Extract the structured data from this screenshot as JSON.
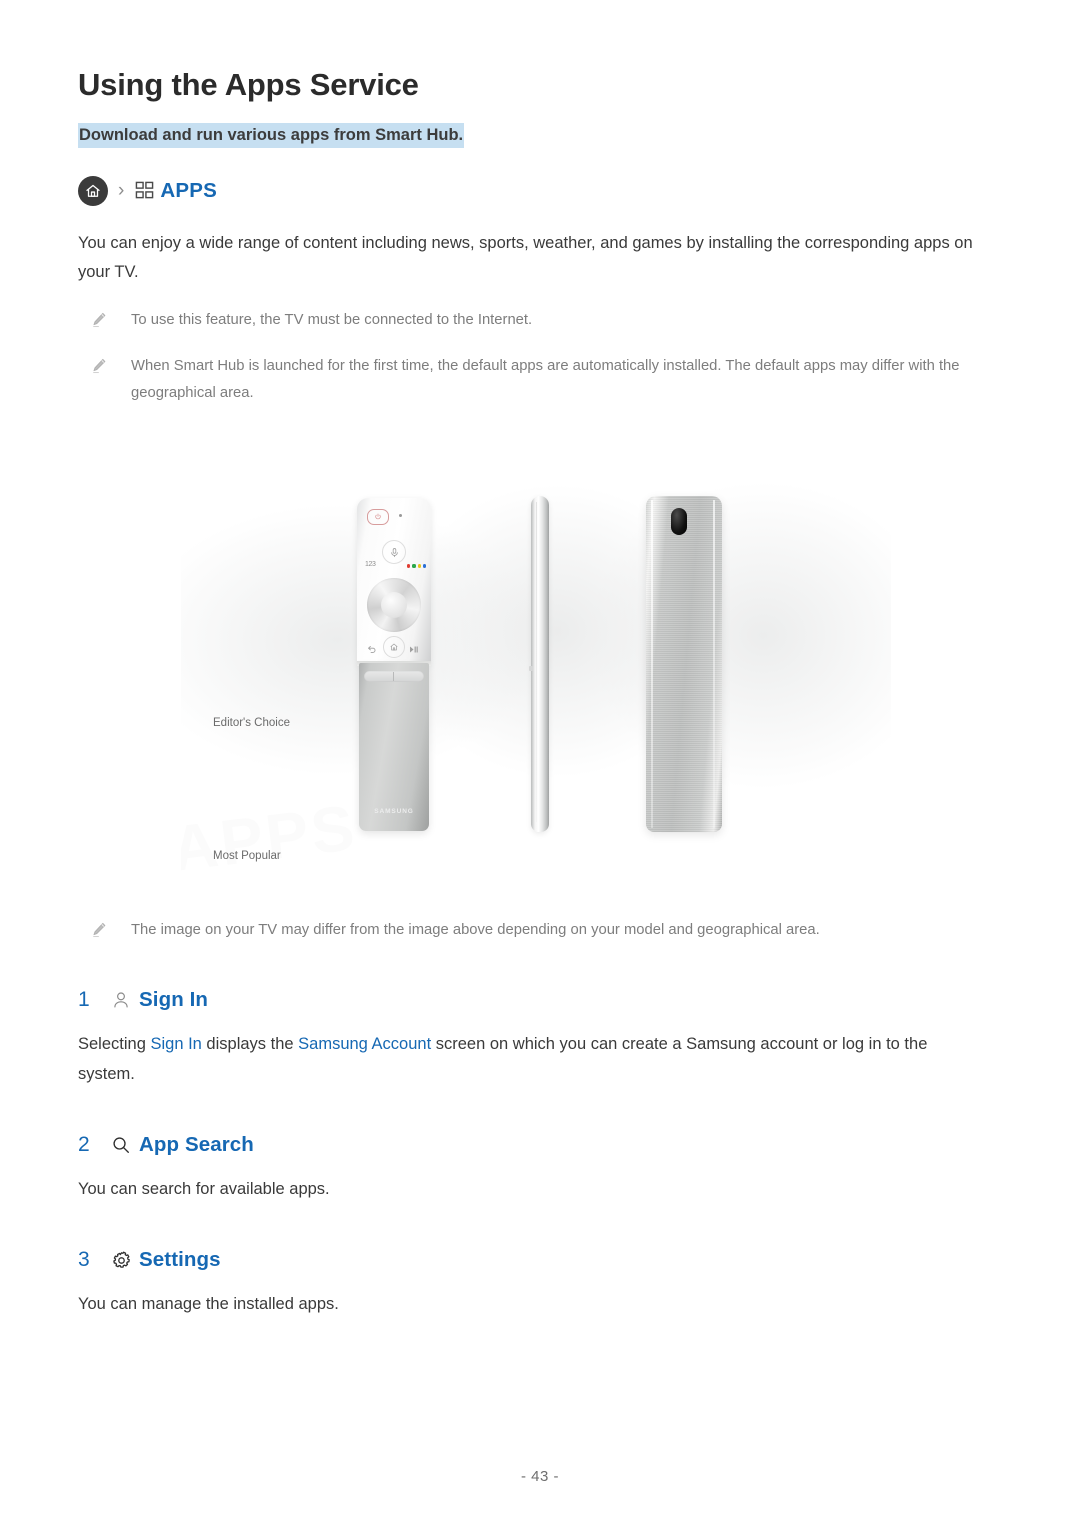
{
  "document": {
    "title": "Using the Apps Service",
    "subtitle": "Download and run various apps from Smart Hub.",
    "page_number": "- 43 -",
    "accent_color": "#1668b3",
    "highlight_color": "#c6dff1",
    "note_color": "#7d7d7d",
    "body_color": "#3a3a3a"
  },
  "breadcrumb": {
    "home_icon": "home-icon",
    "separator": "›",
    "grid_icon": "apps-grid-icon",
    "label": "APPS"
  },
  "intro": {
    "paragraph": "You can enjoy a wide range of content including news, sports, weather, and games by installing the corresponding apps on your TV."
  },
  "notes": [
    {
      "icon": "pencil-icon",
      "text": "To use this feature, the TV must be connected to the Internet."
    },
    {
      "icon": "pencil-icon",
      "text": "When Smart Hub is launched for the first time, the default apps are automatically installed. The default apps may differ with the geographical area."
    }
  ],
  "figure": {
    "watermark": "APPS",
    "caption_editors_choice": "Editor's Choice",
    "caption_most_popular": "Most Popular",
    "remote_front": {
      "power_icon": "power-icon",
      "led_indicator": "led-dot",
      "mic_icon": "microphone-icon",
      "numeric_label": "123",
      "color_buttons": [
        "#e03c31",
        "#2aa74a",
        "#e8c61c",
        "#2a6fd6"
      ],
      "dpad_icon": "directional-pad",
      "back_icon": "back-arrow-icon",
      "home_icon": "home-icon",
      "play_pause_icon": "play-pause-icon",
      "rocker_icon": "volume-channel-rocker",
      "brand": "SAMSUNG"
    },
    "remote_back": {
      "ir_window_icon": "ir-window"
    },
    "note": {
      "icon": "pencil-icon",
      "text": "The image on your TV may differ from the image above depending on your model and geographical area."
    }
  },
  "sections": [
    {
      "number": "1",
      "icon": "person-icon",
      "label": "Sign In",
      "body_prefix": "Selecting ",
      "link_1": "Sign In",
      "body_middle": " displays the ",
      "link_2": "Samsung Account",
      "body_suffix": " screen on which you can create a Samsung account or log in to the system."
    },
    {
      "number": "2",
      "icon": "search-icon",
      "label": "App Search",
      "body": "You can search for available apps."
    },
    {
      "number": "3",
      "icon": "gear-icon",
      "label": "Settings",
      "body": "You can manage the installed apps."
    }
  ]
}
